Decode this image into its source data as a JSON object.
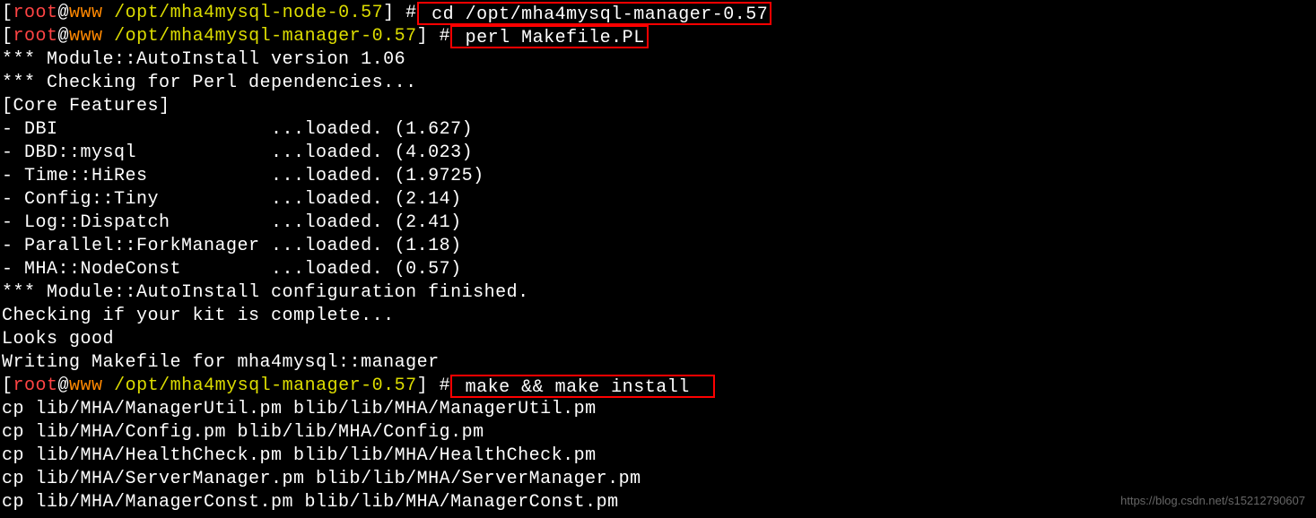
{
  "prompt": {
    "bracket_open": "[",
    "bracket_close": "]",
    "root": "root",
    "at": "@",
    "host": "www",
    "hash": " #",
    "path1": " /opt/mha4mysql-node-0.57",
    "path2": " /opt/mha4mysql-manager-0.57",
    "path3": " /opt/mha4mysql-manager-0.57"
  },
  "cmd1": " cd /opt/mha4mysql-manager-0.57",
  "cmd2": " perl Makefile.PL",
  "cmd3": " make && make install",
  "out": {
    "l1": "*** Module::AutoInstall version 1.06",
    "l2": "*** Checking for Perl dependencies...",
    "l3": "[Core Features]",
    "l4": "- DBI                   ...loaded. (1.627)",
    "l5": "- DBD::mysql            ...loaded. (4.023)",
    "l6": "- Time::HiRes           ...loaded. (1.9725)",
    "l7": "- Config::Tiny          ...loaded. (2.14)",
    "l8": "- Log::Dispatch         ...loaded. (2.41)",
    "l9": "- Parallel::ForkManager ...loaded. (1.18)",
    "l10": "- MHA::NodeConst        ...loaded. (0.57)",
    "l11": "*** Module::AutoInstall configuration finished.",
    "l12": "Checking if your kit is complete...",
    "l13": "Looks good",
    "l14": "Writing Makefile for mha4mysql::manager",
    "l15": "cp lib/MHA/ManagerUtil.pm blib/lib/MHA/ManagerUtil.pm",
    "l16": "cp lib/MHA/Config.pm blib/lib/MHA/Config.pm",
    "l17": "cp lib/MHA/HealthCheck.pm blib/lib/MHA/HealthCheck.pm",
    "l18": "cp lib/MHA/ServerManager.pm blib/lib/MHA/ServerManager.pm",
    "l19": "cp lib/MHA/ManagerConst.pm blib/lib/MHA/ManagerConst.pm"
  },
  "watermark": "https://blog.csdn.net/s15212790607"
}
